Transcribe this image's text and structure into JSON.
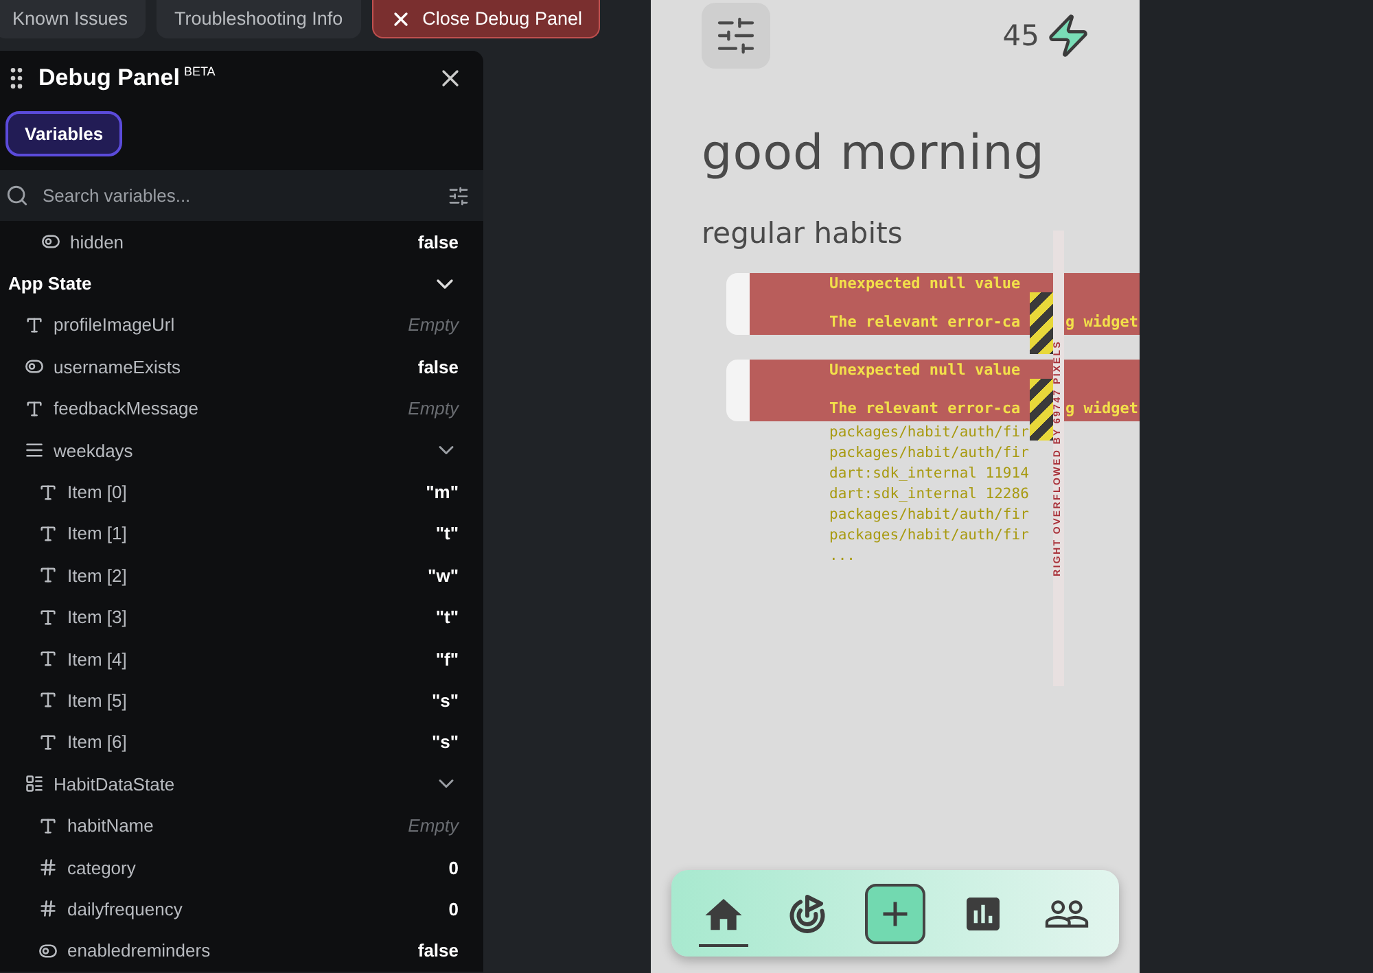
{
  "top_tabs": [
    {
      "label": "Known Issues",
      "kind": "plain"
    },
    {
      "label": "Troubleshooting Info",
      "kind": "plain"
    },
    {
      "label": "Close Debug Panel",
      "kind": "danger"
    }
  ],
  "debug_panel": {
    "title": "Debug Panel",
    "badge": "BETA",
    "tabs": [
      {
        "label": "Variables",
        "selected": true
      }
    ],
    "search": {
      "placeholder": "Search variables..."
    },
    "rows": [
      {
        "kind": "toggle",
        "name": "hidden",
        "value": "false",
        "empty": false
      }
    ],
    "groups": [
      {
        "title": "App State",
        "expanded": true,
        "items": [
          {
            "kind": "text",
            "name": "profileImageUrl",
            "value": "Empty",
            "empty": true
          },
          {
            "kind": "toggle",
            "name": "usernameExists",
            "value": "false",
            "empty": false
          },
          {
            "kind": "text",
            "name": "feedbackMessage",
            "value": "Empty",
            "empty": true
          },
          {
            "kind": "list",
            "name": "weekdays",
            "expanded": true,
            "children": [
              {
                "kind": "text",
                "name": "Item [0]",
                "value": "\"m\"",
                "empty": false
              },
              {
                "kind": "text",
                "name": "Item [1]",
                "value": "\"t\"",
                "empty": false
              },
              {
                "kind": "text",
                "name": "Item [2]",
                "value": "\"w\"",
                "empty": false
              },
              {
                "kind": "text",
                "name": "Item [3]",
                "value": "\"t\"",
                "empty": false
              },
              {
                "kind": "text",
                "name": "Item [4]",
                "value": "\"f\"",
                "empty": false
              },
              {
                "kind": "text",
                "name": "Item [5]",
                "value": "\"s\"",
                "empty": false
              },
              {
                "kind": "text",
                "name": "Item [6]",
                "value": "\"s\"",
                "empty": false
              }
            ]
          },
          {
            "kind": "struct",
            "name": "HabitDataState",
            "expanded": true,
            "children": [
              {
                "kind": "text",
                "name": "habitName",
                "value": "Empty",
                "empty": true
              },
              {
                "kind": "number",
                "name": "category",
                "value": "0",
                "empty": false
              },
              {
                "kind": "number",
                "name": "dailyfrequency",
                "value": "0",
                "empty": false
              },
              {
                "kind": "toggle",
                "name": "enabledreminders",
                "value": "false",
                "empty": false
              }
            ]
          }
        ]
      }
    ]
  },
  "phone": {
    "points": "45",
    "greeting": "good morning",
    "section": "regular habits",
    "overflow_label": "RIGHT OVERFLOWED BY 69747 PIXELS",
    "errors": [
      {
        "left_lines": [
          "Unexpected null value",
          "The relevant error-ca"
        ],
        "right_line": "g widget"
      },
      {
        "left_lines": [
          "Unexpected null value",
          "The relevant error-ca"
        ],
        "right_line": "g widget"
      }
    ],
    "trace": [
      "packages/habit/auth/fir",
      "packages/habit/auth/fir",
      "dart:sdk_internal 11914",
      "dart:sdk_internal 12286",
      "packages/habit/auth/fir",
      "packages/habit/auth/fir",
      "..."
    ],
    "nav": [
      {
        "kind": "home",
        "selected": true
      },
      {
        "kind": "goal",
        "selected": false
      },
      {
        "kind": "add",
        "selected": false
      },
      {
        "kind": "stats",
        "selected": false
      },
      {
        "kind": "people",
        "selected": false
      }
    ]
  }
}
